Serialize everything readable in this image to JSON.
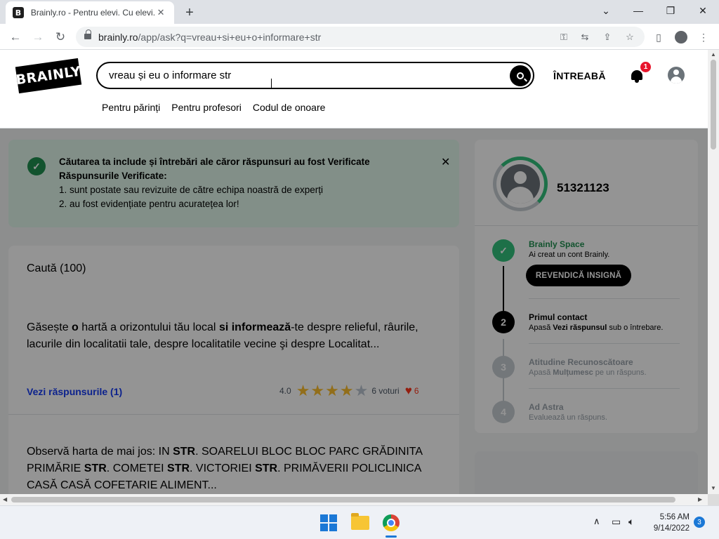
{
  "browser": {
    "tab_title": "Brainly.ro - Pentru elevi. Cu elevi.",
    "favicon_letter": "B",
    "url_host": "brainly.ro",
    "url_path": "/app/ask?q=vreau+si+eu+o+informare+str"
  },
  "header": {
    "logo_text": "BRAINLY",
    "search_value": "vreau și eu o informare str",
    "ask_label": "ÎNTREABĂ",
    "notification_count": "1",
    "subnav": [
      "Pentru părinți",
      "Pentru profesori",
      "Codul de onoare"
    ]
  },
  "notice": {
    "line1": "Căutarea ta include și întrebări ale căror răspunsuri au fost Verificate",
    "line2": "Răspunsurile Verificate:",
    "line3": "1. sunt postate sau revizuite de către echipa noastră de experți",
    "line4": "2. au fost evidențiate pentru acuratețea lor!",
    "close_glyph": "✕"
  },
  "results": {
    "heading": "Caută (100)",
    "items": [
      {
        "text_html_parts": [
          "Găsește ",
          "o",
          " hartă a orizontului tău local ",
          "si informează",
          "-te despre relieful, râurile, lacurile din localitatii tale, despre localitatile vecine şi despre Localitat..."
        ],
        "see_answers": "Vezi răspunsurile (1)",
        "rating": "4.0",
        "votes": "6 voturi",
        "likes": "6",
        "stars_filled": 4,
        "stars_total": 5
      },
      {
        "parts": [
          "Observă harta de mai jos: IN ",
          "STR",
          ". SOARELUI BLOC BLOC PARC GRĂDINITA PRIMĂRIE ",
          "STR",
          ". COMETEI ",
          "STR",
          ". VICTORIEI ",
          "STR",
          ". PRIMĂVERII POLICLINICA CASĂ CASĂ COFETARIE ALIMENT..."
        ]
      }
    ]
  },
  "sidebar": {
    "username": "51321123",
    "steps": [
      {
        "number": "✓",
        "title": "Brainly Space",
        "desc": "Ai creat un cont Brainly.",
        "button": "REVENDICĂ INSIGNĂ"
      },
      {
        "number": "2",
        "title": "Primul contact",
        "desc_pre": "Apasă ",
        "desc_bold": "Vezi răspunsul",
        "desc_post": " sub o întrebare."
      },
      {
        "number": "3",
        "title": "Atitudine Recunoscătoare",
        "desc_pre": "Apasă ",
        "desc_bold": "Mulțumesc",
        "desc_post": " pe un răspuns."
      },
      {
        "number": "4",
        "title": "Ad Astra",
        "desc": "Evaluează un răspuns."
      }
    ]
  },
  "taskbar": {
    "time": "5:56 AM",
    "date": "9/14/2022",
    "notification_count": "3"
  },
  "colors": {
    "brand_black": "#000000",
    "verified_green": "#1f8f50",
    "link_blue": "#163bf3",
    "star_gold": "#fbbe2e",
    "heart_red": "#ff341a",
    "badge_red": "#e8152c"
  }
}
